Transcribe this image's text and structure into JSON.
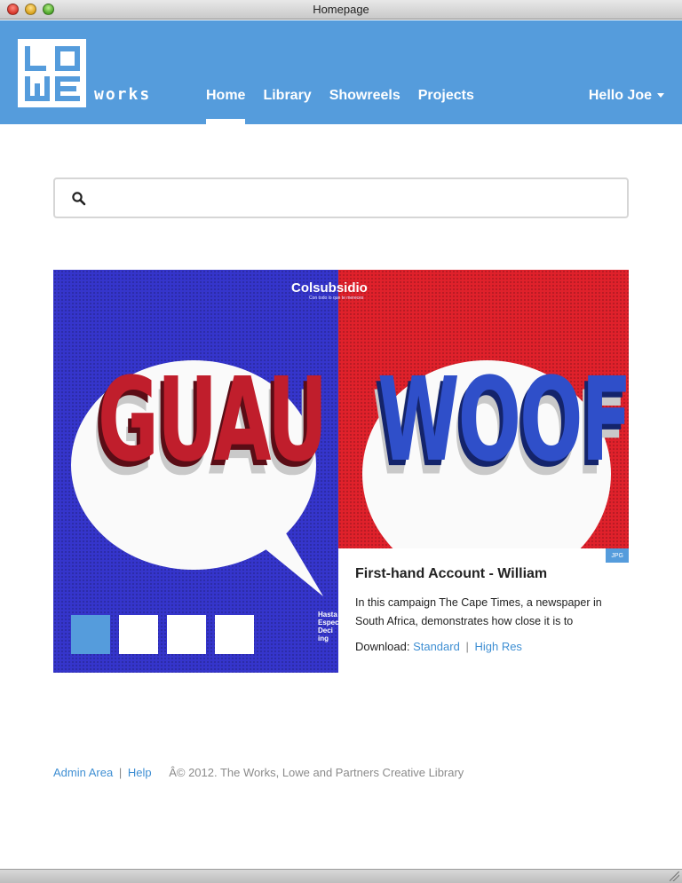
{
  "window": {
    "title": "Homepage"
  },
  "header": {
    "logo_letters": [
      "L",
      "O",
      "W",
      "E"
    ],
    "logo_suffix": "works",
    "nav": [
      {
        "label": "Home",
        "active": true
      },
      {
        "label": "Library",
        "active": false
      },
      {
        "label": "Showreels",
        "active": false
      },
      {
        "label": "Projects",
        "active": false
      }
    ],
    "user_menu": "Hello Joe",
    "accent_color": "#559cdc"
  },
  "search": {
    "value": "",
    "placeholder": ""
  },
  "feature": {
    "image_words": {
      "left": "GUAU",
      "right": "WOOF"
    },
    "brand": "Colsubsidio",
    "brand_tagline": "Con todo lo que te mereces",
    "side_text": "Hasta Espec Deci ing",
    "thumbnails": [
      {
        "active": true
      },
      {
        "active": false
      },
      {
        "active": false
      },
      {
        "active": false
      }
    ],
    "badge": "JPG",
    "title": "First-hand Account - William",
    "description": "In this campaign The Cape Times, a newspaper in South Africa, demonstrates how close it is to",
    "download_label": "Download:",
    "download_standard": "Standard",
    "download_sep": "|",
    "download_highres": "High Res"
  },
  "footer": {
    "admin": "Admin Area",
    "sep": "|",
    "help": "Help",
    "copyright": "Â© 2012. The Works, Lowe and Partners Creative Library"
  }
}
